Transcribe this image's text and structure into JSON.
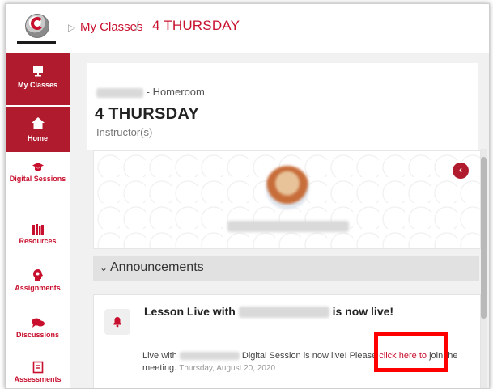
{
  "breadcrumb": {
    "parent": "My Classes",
    "separator": "/",
    "current": "4 THURSDAY"
  },
  "sidebar": {
    "items": [
      {
        "label": "My Classes",
        "icon": "presentation-board-icon",
        "active": true
      },
      {
        "label": "Home",
        "icon": "home-icon",
        "active": true
      },
      {
        "label": "Digital Sessions",
        "icon": "graduation-cap-icon",
        "active": false
      },
      {
        "label": "Resources",
        "icon": "books-icon",
        "active": false
      },
      {
        "label": "Assignments",
        "icon": "head-gears-icon",
        "active": false
      },
      {
        "label": "Discussions",
        "icon": "chat-bubbles-icon",
        "active": false
      },
      {
        "label": "Assessments",
        "icon": "clipboard-icon",
        "active": false
      }
    ]
  },
  "class_header": {
    "subtitle_suffix": "- Homeroom",
    "title": "4 THURSDAY",
    "instructors_label": "Instructor(s)"
  },
  "announcements": {
    "section_label": "Announcements",
    "items": [
      {
        "headline_prefix": "Lesson Live with",
        "headline_suffix": "is now live!",
        "body_prefix": "Live with",
        "body_middle": "Digital Session is now live! Please",
        "link_text": "click here to",
        "body_suffix": "join the meeting.",
        "date": "Thursday, August 20, 2020"
      }
    ]
  },
  "colors": {
    "accent": "#c8102e",
    "sidebar_active": "#b01c2e",
    "highlight": "#ff0000"
  }
}
